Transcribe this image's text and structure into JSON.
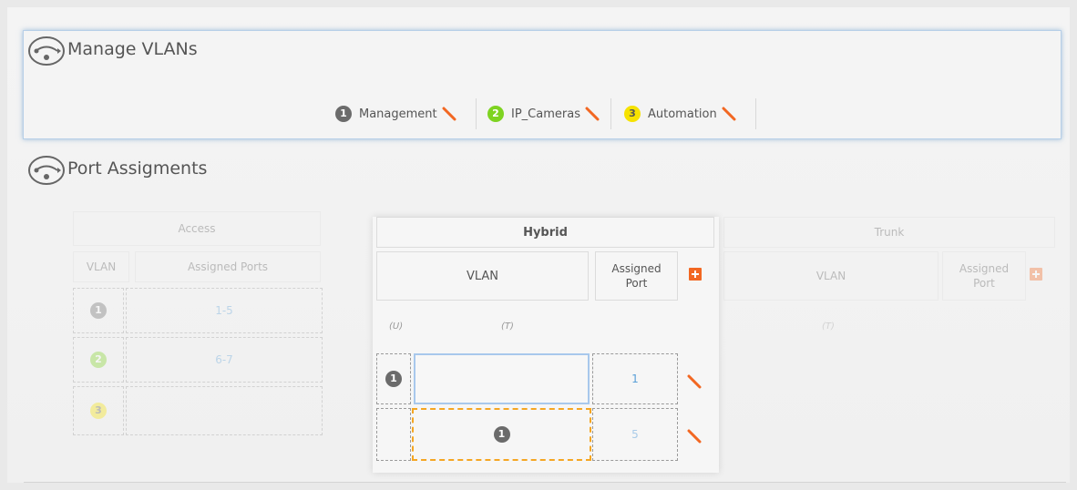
{
  "manage_vlans": {
    "title": "Manage VLANs",
    "icon": "network-cable-icon",
    "vlans": [
      {
        "number": "1",
        "name": "Management",
        "color": "#6b6b6b"
      },
      {
        "number": "2",
        "name": "IP_Cameras",
        "color": "#7ed321"
      },
      {
        "number": "3",
        "name": "Automation",
        "color": "#f6e200"
      }
    ]
  },
  "port_assignments": {
    "title": "Port Assigments",
    "icon": "network-cable-icon",
    "access": {
      "header": "Access",
      "col_vlan": "VLAN",
      "col_ports": "Assigned Ports",
      "rows": [
        {
          "vlan": "1",
          "ports": "1-5"
        },
        {
          "vlan": "2",
          "ports": "6-7"
        },
        {
          "vlan": "3",
          "ports": ""
        }
      ]
    },
    "hybrid": {
      "header": "Hybrid",
      "col_vlan": "VLAN",
      "col_port": "Assigned Port",
      "label_untagged": "(U)",
      "label_tagged": "(T)",
      "rows": [
        {
          "untagged": "1",
          "tagged": "",
          "port": "1"
        },
        {
          "untagged": "",
          "tagged": "1",
          "port": "5"
        }
      ]
    },
    "trunk": {
      "header": "Trunk",
      "col_vlan": "VLAN",
      "col_port": "Assigned Port",
      "label_tagged": "(T)"
    }
  },
  "colors": {
    "accent_orange": "#f26722",
    "link_blue": "#5aa0d8",
    "focus_blue": "#a8c8ec"
  }
}
